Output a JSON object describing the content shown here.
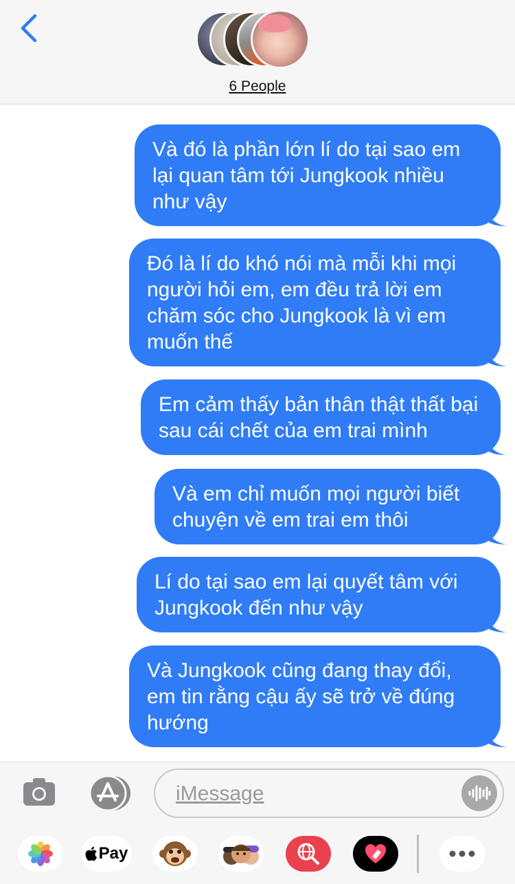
{
  "header": {
    "back_label": "<",
    "group_title": "6 People",
    "participants_count": 5
  },
  "messages": [
    {
      "text": "Và đó là phần lớn lí do tại sao em lại quan tâm tới Jungkook nhiều như vậy"
    },
    {
      "text": "Đó là lí do khó nói mà mỗi khi mọi người hỏi em, em đều trả lời em chăm sóc cho Jungkook là vì em muốn thế"
    },
    {
      "text": "Em cảm thấy bản thân thật thất bại sau cái chết của em trai mình"
    },
    {
      "text": "Và em chỉ muốn mọi người biết chuyện về em trai em thôi"
    },
    {
      "text": "Lí do tại sao em lại quyết tâm với Jungkook đến như vậy"
    },
    {
      "text": "Và Jungkook cũng đang thay đổi, em tin rằng cậu ấy sẽ trở về đúng hướng"
    }
  ],
  "input": {
    "placeholder": "iMessage",
    "camera_icon": "camera-icon",
    "appstore_icon": "app-store-icon",
    "audio_icon": "waveform-icon"
  },
  "drawer": {
    "apple_pay_label": "Pay",
    "items": [
      "photos-icon",
      "apple-pay-icon",
      "monkey-animoji-icon",
      "memoji-icon",
      "web-image-search-icon",
      "digital-touch-heart-icon",
      "more-icon"
    ]
  },
  "colors": {
    "bubble": "#2f7cf6",
    "header_bg": "#f6f6f6",
    "accent": "#2f7cf6"
  }
}
